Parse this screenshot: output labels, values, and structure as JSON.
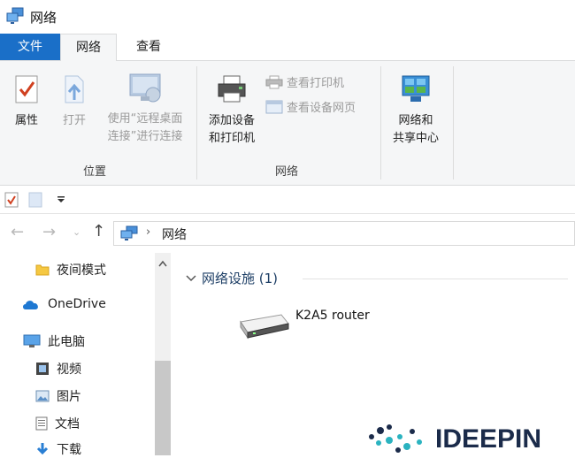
{
  "window": {
    "title": "网络"
  },
  "tabs": [
    {
      "label": "文件"
    },
    {
      "label": "网络"
    },
    {
      "label": "查看"
    }
  ],
  "ribbon": {
    "location_group": {
      "label": "位置",
      "properties": "属性",
      "open": "打开",
      "remote_line1": "使用“远程桌面",
      "remote_line2": "连接”进行连接"
    },
    "network_group": {
      "label": "网络",
      "add_line1": "添加设备",
      "add_line2": "和打印机",
      "view_printers": "查看打印机",
      "view_device_webpage": "查看设备网页"
    },
    "sharing": {
      "line1": "网络和",
      "line2": "共享中心"
    }
  },
  "address": {
    "location": "网络"
  },
  "nav": {
    "items": [
      {
        "label": "夜间模式"
      },
      {
        "label": "OneDrive"
      },
      {
        "label": "此电脑"
      },
      {
        "label": "视频"
      },
      {
        "label": "图片"
      },
      {
        "label": "文档"
      },
      {
        "label": "下载"
      }
    ]
  },
  "content": {
    "group_title": "网络设施 (1)",
    "device": {
      "name": "K2A5 router"
    }
  },
  "watermark": {
    "text": "IDEEPIN"
  },
  "colors": {
    "accent": "#1a6fc8",
    "ribbon_bg": "#f5f6f7",
    "disabled_text": "#9a9a9a"
  }
}
